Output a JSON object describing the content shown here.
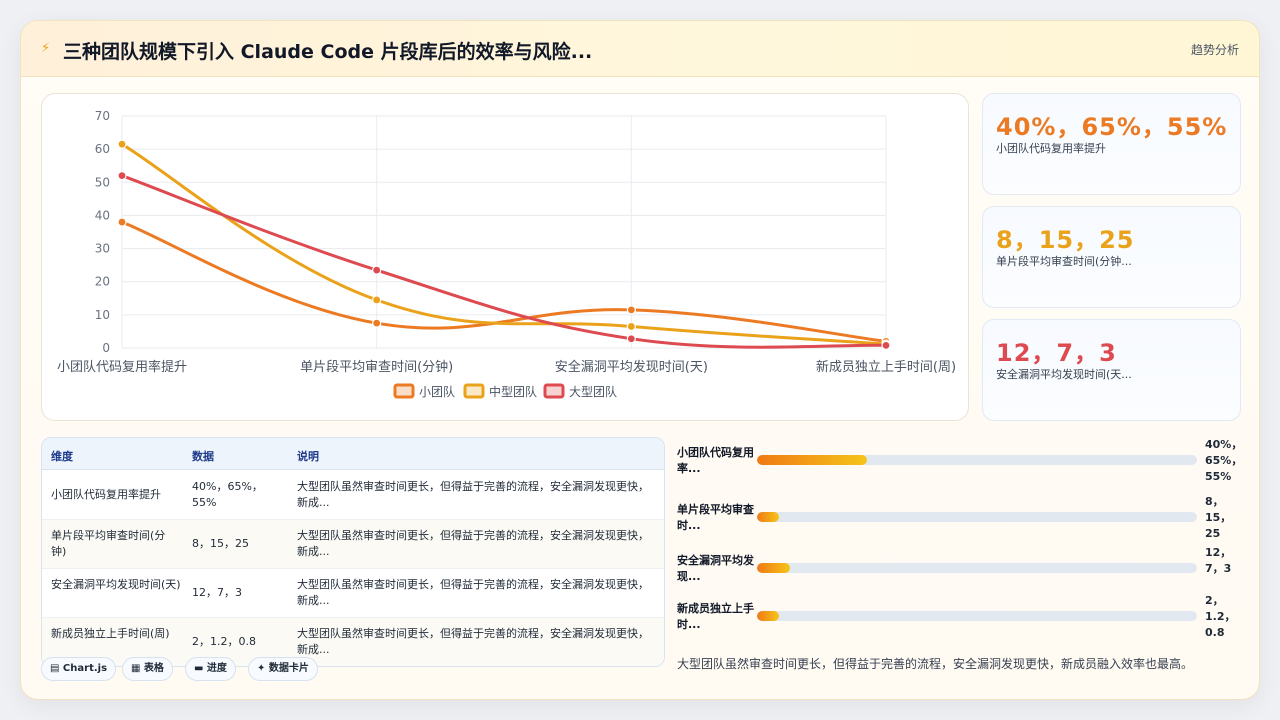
{
  "header": {
    "title": "三种团队规模下引入 Claude Code 片段库后的效率与风险...",
    "subtitle": "趋势分析"
  },
  "chart_data": {
    "type": "line",
    "categories": [
      "小团队代码复用率提升",
      "单片段平均审查时间(分钟)",
      "安全漏洞平均发现时间(天)",
      "新成员独立上手时间(周)"
    ],
    "series": [
      {
        "name": "小团队",
        "color": "#ec7a23",
        "values": [
          38,
          7.5,
          11.5,
          2
        ]
      },
      {
        "name": "中型团队",
        "color": "#eaa21a",
        "values": [
          61.5,
          14.5,
          6.5,
          1.2
        ]
      },
      {
        "name": "大型团队",
        "color": "#dd4a4f",
        "values": [
          52,
          23.5,
          2.8,
          0.8
        ]
      }
    ],
    "ylim": [
      0,
      70
    ],
    "yticks": [
      0,
      10,
      20,
      30,
      40,
      50,
      60,
      70
    ],
    "grid": true,
    "legend": "bottom"
  },
  "kpis": [
    {
      "value": "40%，65%，55%",
      "label": "小团队代码复用率提升",
      "color": "#ec7a23"
    },
    {
      "value": "8，15，25",
      "label": "单片段平均审查时间(分钟...",
      "color": "#eaa21a"
    },
    {
      "value": "12，7，3",
      "label": "安全漏洞平均发现时间(天...",
      "color": "#dd4a4f"
    }
  ],
  "table": {
    "headers": [
      "维度",
      "数据",
      "说明"
    ],
    "rows": [
      {
        "dim": "小团队代码复用率提升",
        "data": "40%，65%，55%",
        "desc": "大型团队虽然审查时间更长，但得益于完善的流程，安全漏洞发现更快，新成..."
      },
      {
        "dim": "单片段平均审查时间(分钟)",
        "data": "8，15，25",
        "desc": "大型团队虽然审查时间更长，但得益于完善的流程，安全漏洞发现更快，新成..."
      },
      {
        "dim": "安全漏洞平均发现时间(天)",
        "data": "12，7，3",
        "desc": "大型团队虽然审查时间更长，但得益于完善的流程，安全漏洞发现更快，新成..."
      },
      {
        "dim": "新成员独立上手时间(周)",
        "data": "2，1.2，0.8",
        "desc": "大型团队虽然审查时间更长，但得益于完善的流程，安全漏洞发现更快，新成..."
      }
    ]
  },
  "chips": [
    "▤ Chart.js",
    "▦ 表格",
    "▬ 进度",
    "✦ 数据卡片"
  ],
  "progress": [
    {
      "label": "小团队代码复用率...",
      "value": "40%，65%，55%",
      "fraction": 0.25
    },
    {
      "label": "单片段平均审查时...",
      "value": "8，15，25",
      "fraction": 0.05
    },
    {
      "label": "安全漏洞平均发现...",
      "value": "12，7，3",
      "fraction": 0.075
    },
    {
      "label": "新成员独立上手时...",
      "value": "2，1.2，0.8",
      "fraction": 0.05
    }
  ],
  "summary": "大型团队虽然审查时间更长，但得益于完善的流程，安全漏洞发现更快，新成员融入效率也最高。"
}
